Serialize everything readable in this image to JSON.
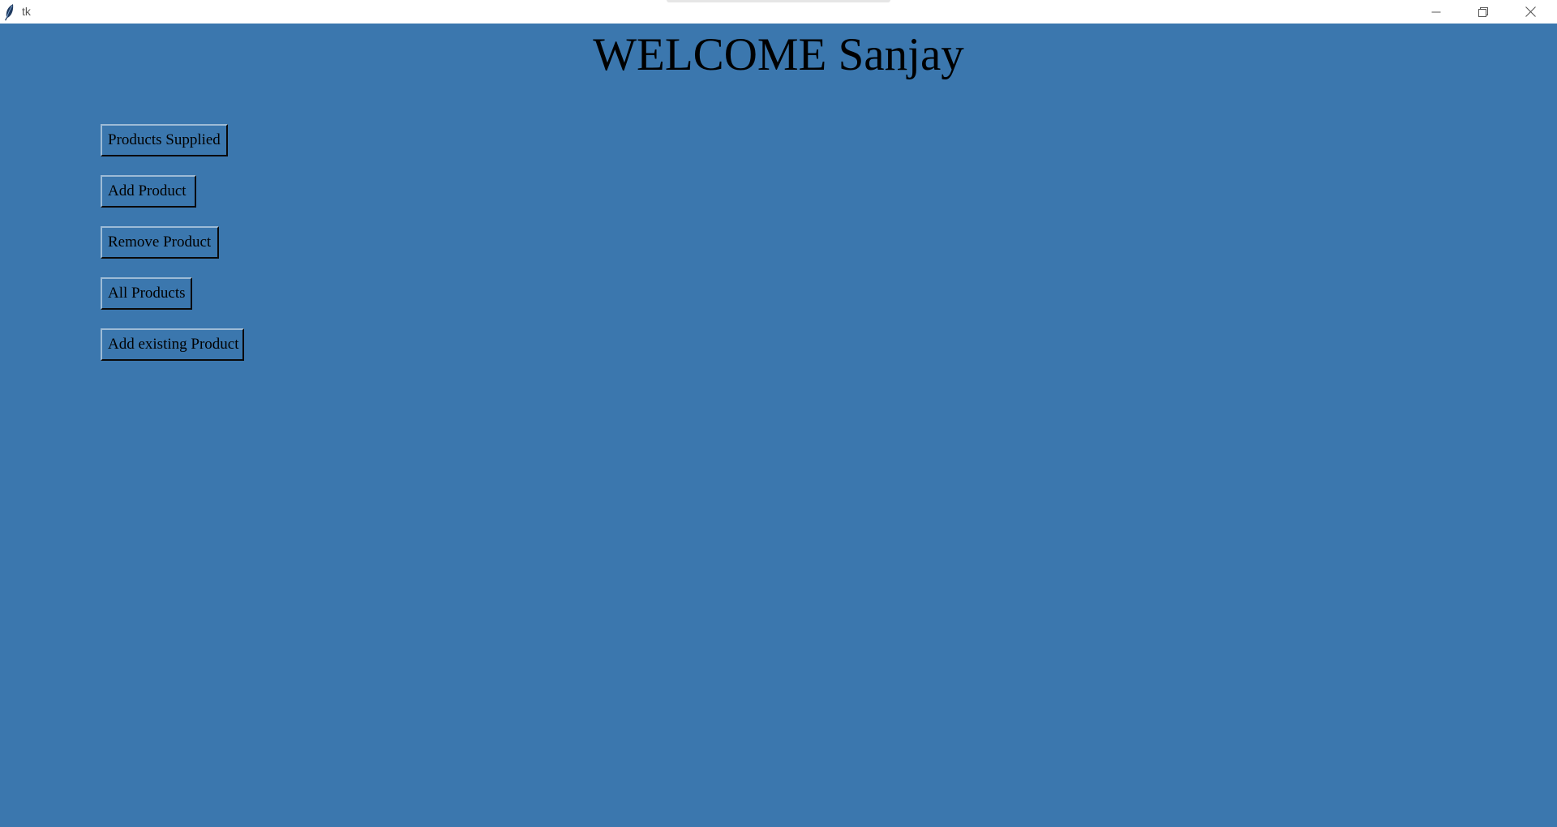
{
  "window": {
    "title": "tk",
    "app_icon": "feather-icon",
    "controls": {
      "minimize": "minimize-icon",
      "restore": "restore-icon",
      "close": "close-icon"
    }
  },
  "main": {
    "heading": "WELCOME Sanjay",
    "background_color": "#3b77ae",
    "buttons": [
      {
        "label": "Products Supplied"
      },
      {
        "label": "Add Product"
      },
      {
        "label": "Remove Product"
      },
      {
        "label": "All Products"
      },
      {
        "label": "Add existing Product"
      }
    ]
  }
}
